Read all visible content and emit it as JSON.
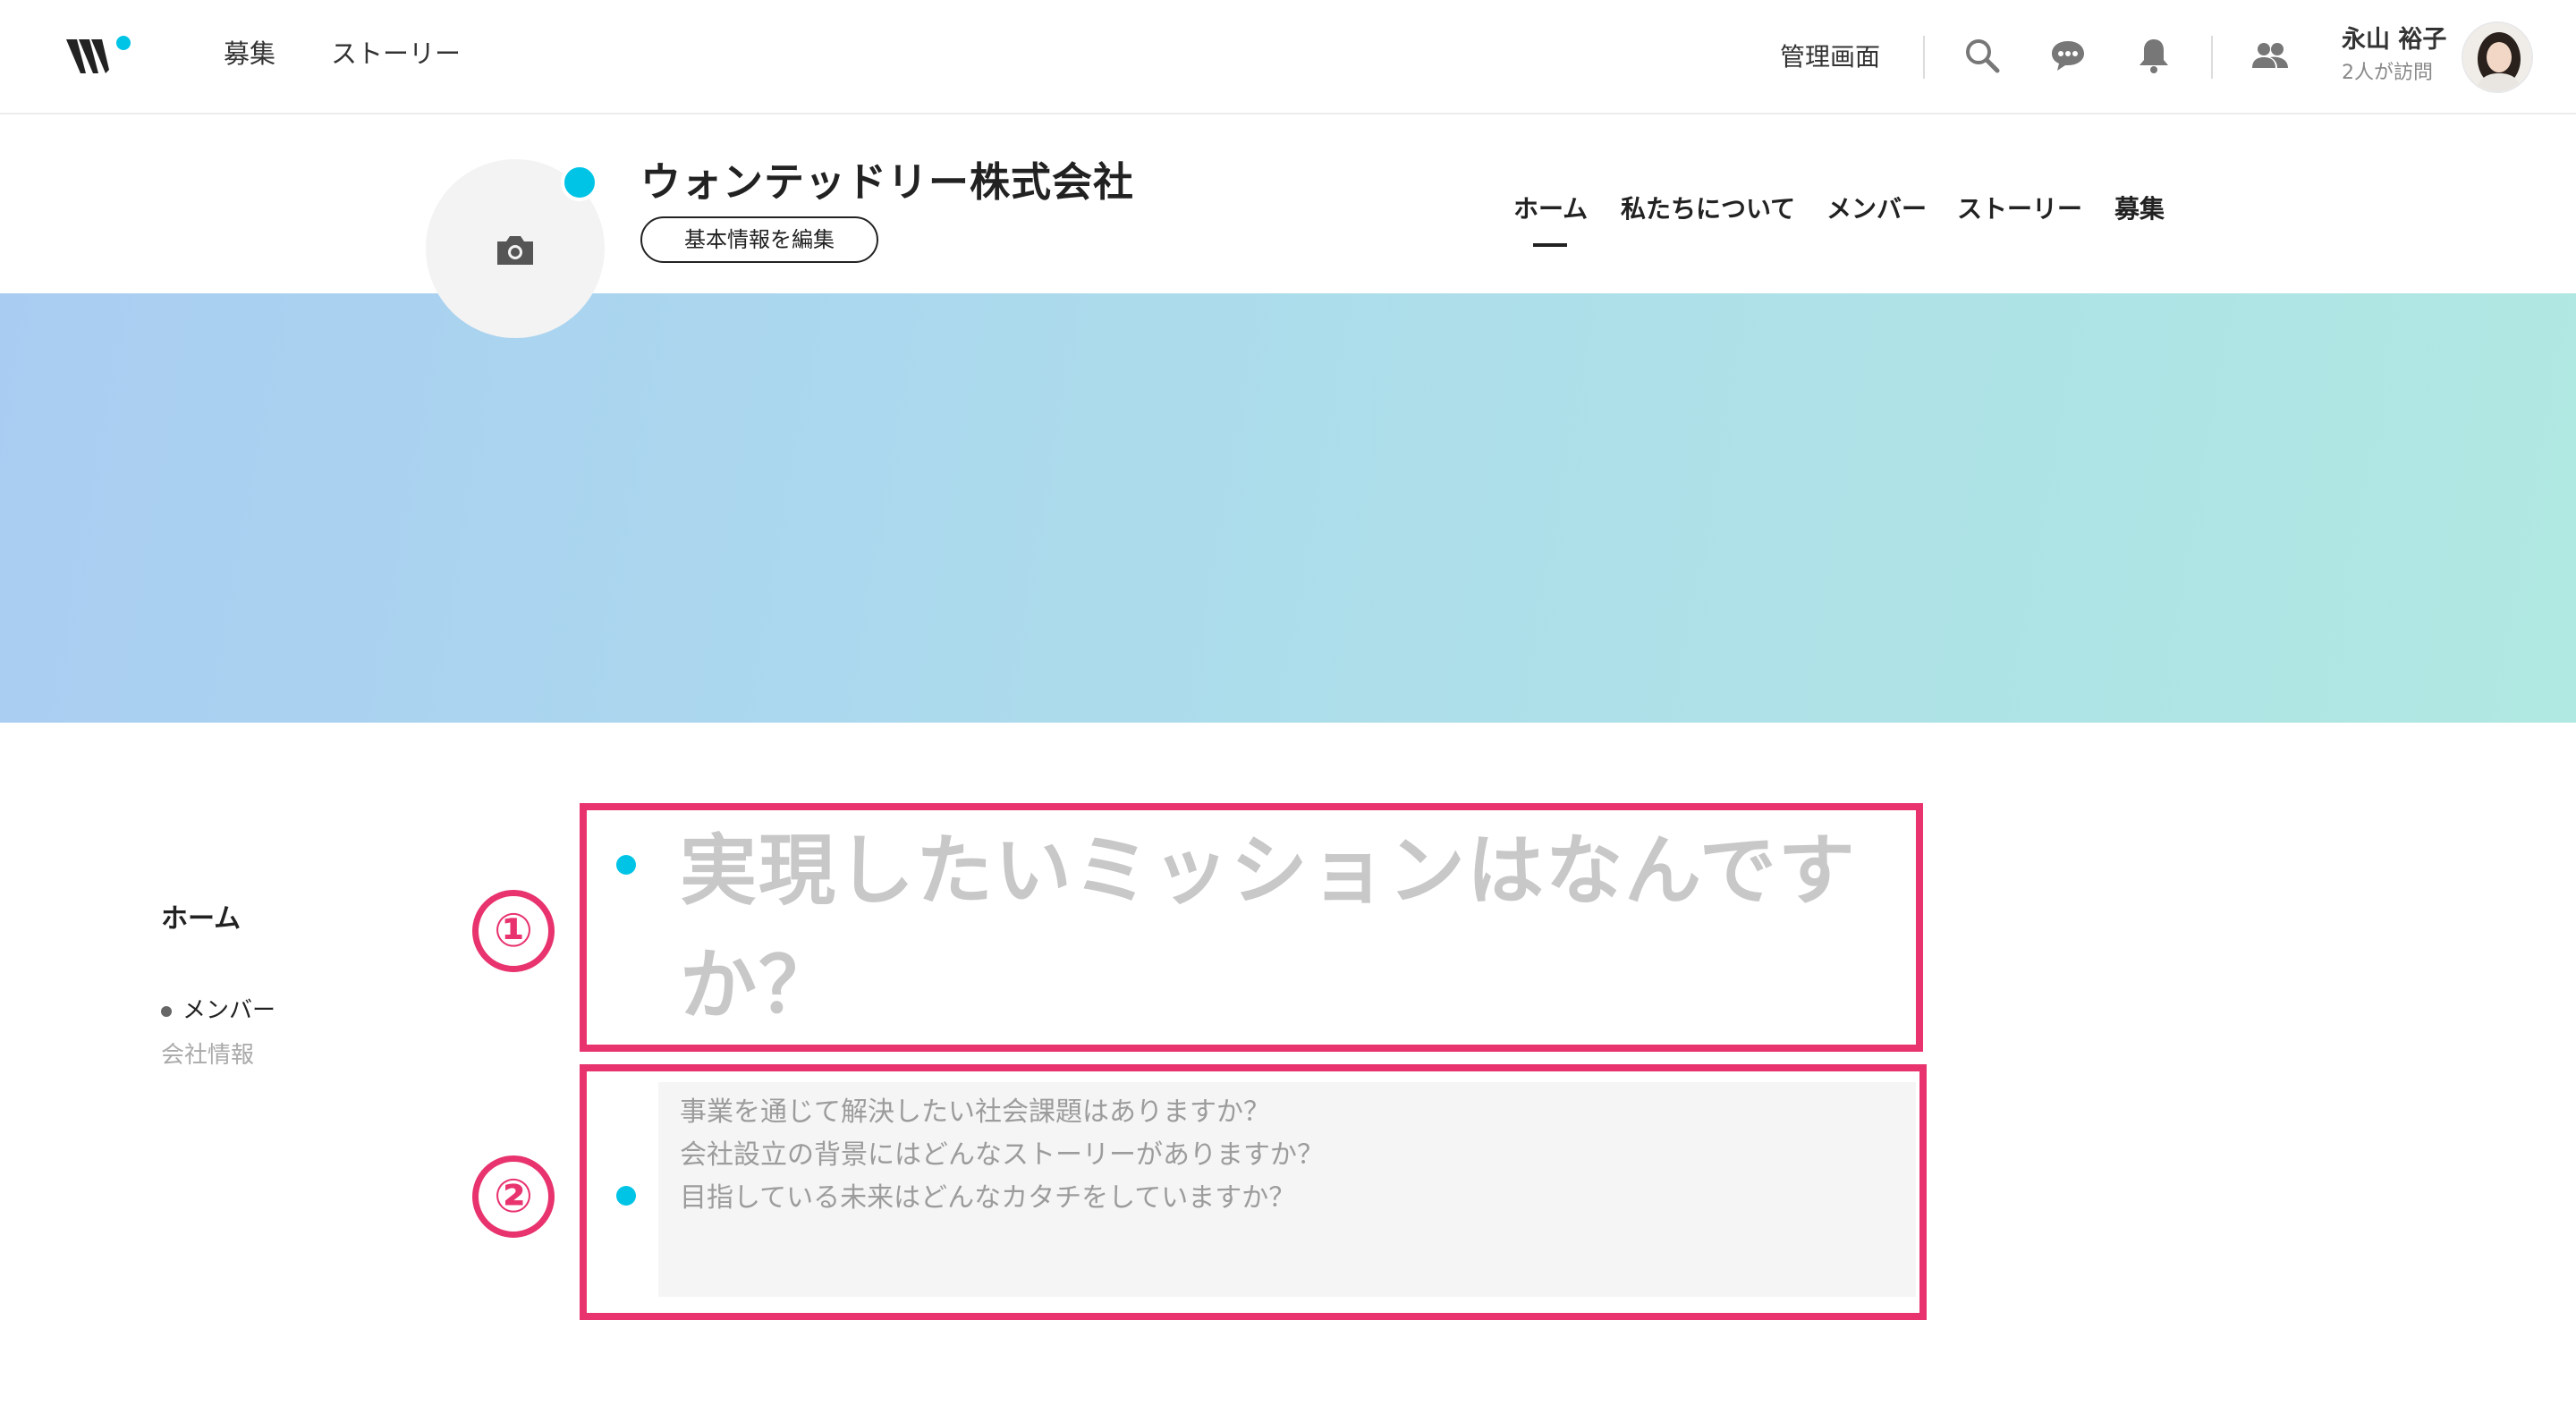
{
  "topnav": {
    "links": [
      "募集",
      "ストーリー"
    ],
    "admin_label": "管理画面",
    "icons": [
      "search-icon",
      "chat-icon",
      "bell-icon",
      "people-icon"
    ],
    "user": {
      "name": "永山 裕子",
      "sub": "2人が訪問"
    }
  },
  "company": {
    "name": "ウォンテッドリー株式会社",
    "edit_label": "基本情報を編集",
    "tabs": [
      "ホーム",
      "私たちについて",
      "メンバー",
      "ストーリー",
      "募集"
    ],
    "active_tab": "ホーム"
  },
  "sidebar": {
    "home": "ホーム",
    "items": [
      "メンバー",
      "会社情報"
    ]
  },
  "annotations": {
    "marker1": "①",
    "marker2": "②"
  },
  "section1": {
    "title_line1": "実現したいミッションはなんです",
    "title_line2": "か？"
  },
  "section2": {
    "lines": [
      "事業を通じて解決したい社会課題はありますか？",
      "会社設立の背景にはどんなストーリーがありますか？",
      "目指している未来はどんなカタチをしていますか？"
    ]
  },
  "colors": {
    "accent": "#00c4e6",
    "annotation": "#e8336e",
    "hero_start": "#a9cdf2",
    "hero_end": "#b0e8e2"
  }
}
